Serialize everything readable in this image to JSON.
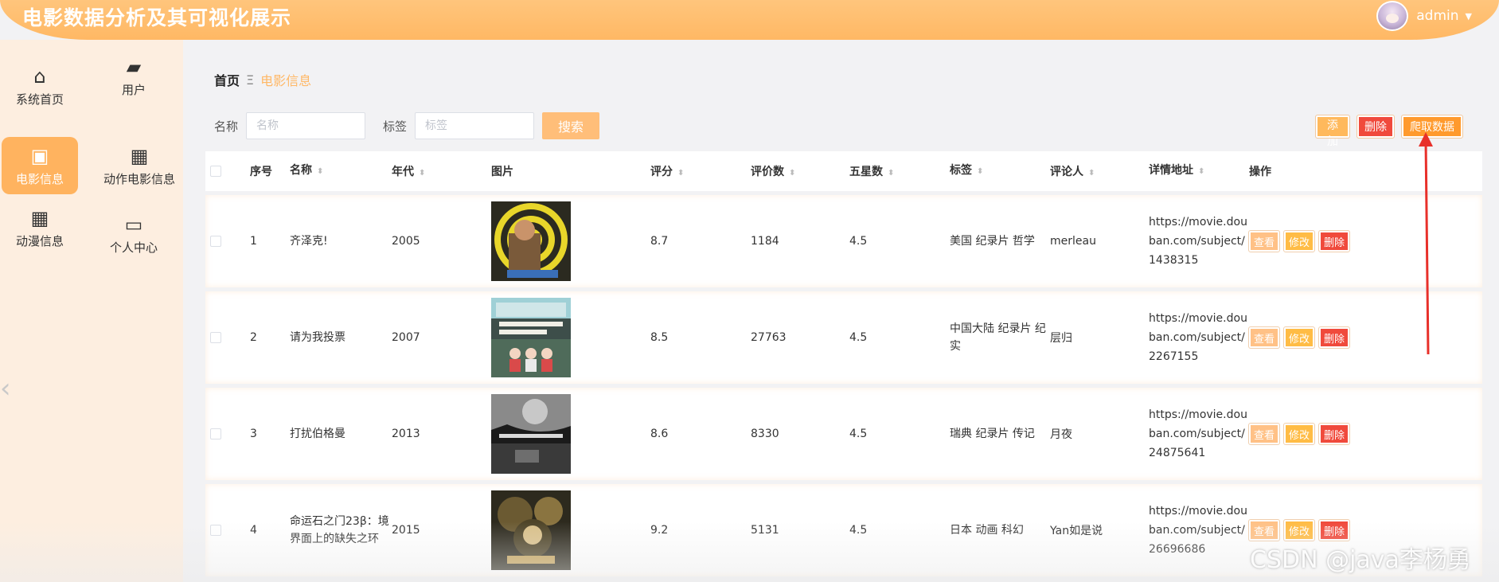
{
  "header": {
    "title": "电影数据分析及其可视化展示",
    "username": "admin",
    "caret": "▼",
    "brand_color": "#ffb864"
  },
  "sidebar": {
    "items": [
      {
        "label": "系统首页",
        "icon": "home-icon",
        "glyph": "⌂",
        "active": false
      },
      {
        "label": "用户",
        "icon": "ticket-icon",
        "glyph": "▰",
        "active": false
      },
      {
        "label": "电影信息",
        "icon": "briefcase-icon",
        "glyph": "▣",
        "active": true
      },
      {
        "label": "动作电影信息",
        "icon": "grid-icon",
        "glyph": "▦",
        "active": false
      },
      {
        "label": "动漫信息",
        "icon": "grid-icon",
        "glyph": "▦",
        "active": false
      },
      {
        "label": "个人中心",
        "icon": "card-icon",
        "glyph": "▭",
        "active": false
      }
    ],
    "collapse_glyph": "‹"
  },
  "breadcrumb": {
    "home": "首页",
    "separator": "Ξ",
    "current": "电影信息"
  },
  "search": {
    "name_label": "名称",
    "name_placeholder": "名称",
    "tag_label": "标签",
    "tag_placeholder": "标签",
    "button": "搜索"
  },
  "actions": {
    "add": "添加",
    "delete": "删除",
    "crawl": "爬取数据"
  },
  "table": {
    "headers": {
      "no": "序号",
      "name": "名称",
      "year": "年代",
      "image": "图片",
      "score": "评分",
      "count": "评价数",
      "five": "五星数",
      "tags": "标签",
      "reviewer": "评论人",
      "url": "详情地址",
      "ops": "操作"
    },
    "sort_glyph": "⬍",
    "op_labels": {
      "view": "查看",
      "edit": "修改",
      "delete": "删除"
    },
    "rows": [
      {
        "no": "1",
        "name": "齐泽克!",
        "year": "2005",
        "score": "8.7",
        "count": "1184",
        "five": "4.5",
        "tags": "美国 纪录片 哲学",
        "reviewer": "merleau",
        "url": "https://movie.douban.com/subject/1438315"
      },
      {
        "no": "2",
        "name": "请为我投票",
        "year": "2007",
        "score": "8.5",
        "count": "27763",
        "five": "4.5",
        "tags": "中国大陆 纪录片 纪实",
        "reviewer": "层归",
        "url": "https://movie.douban.com/subject/2267155"
      },
      {
        "no": "3",
        "name": "打扰伯格曼",
        "year": "2013",
        "score": "8.6",
        "count": "8330",
        "five": "4.5",
        "tags": "瑞典 纪录片 传记",
        "reviewer": "月夜",
        "url": "https://movie.douban.com/subject/24875641"
      },
      {
        "no": "4",
        "name": "命运石之门23β：境界面上的缺失之环",
        "year": "2015",
        "score": "9.2",
        "count": "5131",
        "five": "4.5",
        "tags": "日本 动画 科幻",
        "reviewer": "Yan如是说",
        "url": "https://movie.douban.com/subject/26696686"
      }
    ]
  },
  "watermark": "CSDN @java李杨勇"
}
